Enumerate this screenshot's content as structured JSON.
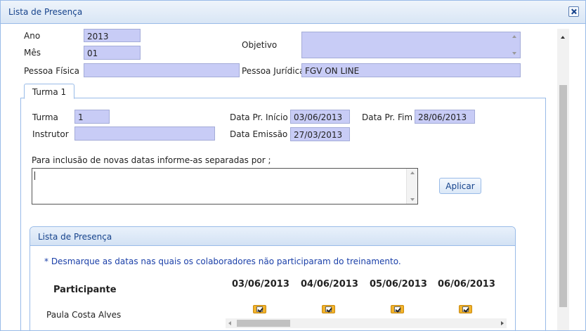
{
  "window": {
    "title": "Lista de Presença",
    "close_icon": "close-icon"
  },
  "form": {
    "ano_label": "Ano",
    "ano_value": "2013",
    "mes_label": "Mês",
    "mes_value": "01",
    "pessoa_fisica_label": "Pessoa Física",
    "pessoa_fisica_value": "",
    "objetivo_label": "Objetivo",
    "objetivo_value": "",
    "pessoa_juridica_label": "Pessoa Jurídica",
    "pessoa_juridica_value": "FGV ON LINE"
  },
  "tabs": [
    {
      "label": "Turma 1"
    }
  ],
  "turma": {
    "turma_label": "Turma",
    "turma_value": "1",
    "instrutor_label": "Instrutor",
    "instrutor_value": "",
    "data_inicio_label": "Data Pr. Início",
    "data_inicio_value": "03/06/2013",
    "data_fim_label": "Data Pr. Fim",
    "data_fim_value": "28/06/2013",
    "data_emissao_label": "Data Emissão",
    "data_emissao_value": "27/03/2013",
    "novas_datas_label": "Para inclusão de novas datas informe-as separadas por ;",
    "novas_datas_value": "",
    "apply_button": "Aplicar"
  },
  "presence": {
    "title": "Lista de Presença",
    "hint": "* Desmarque as datas nas quais os colaboradores não participaram do treinamento.",
    "participant_header": "Participante",
    "dates": [
      "03/06/2013",
      "04/06/2013",
      "05/06/2013",
      "06/06/2013"
    ],
    "rows": [
      {
        "name": "Paula Costa Alves",
        "checked": [
          true,
          true,
          true,
          true
        ]
      }
    ]
  }
}
